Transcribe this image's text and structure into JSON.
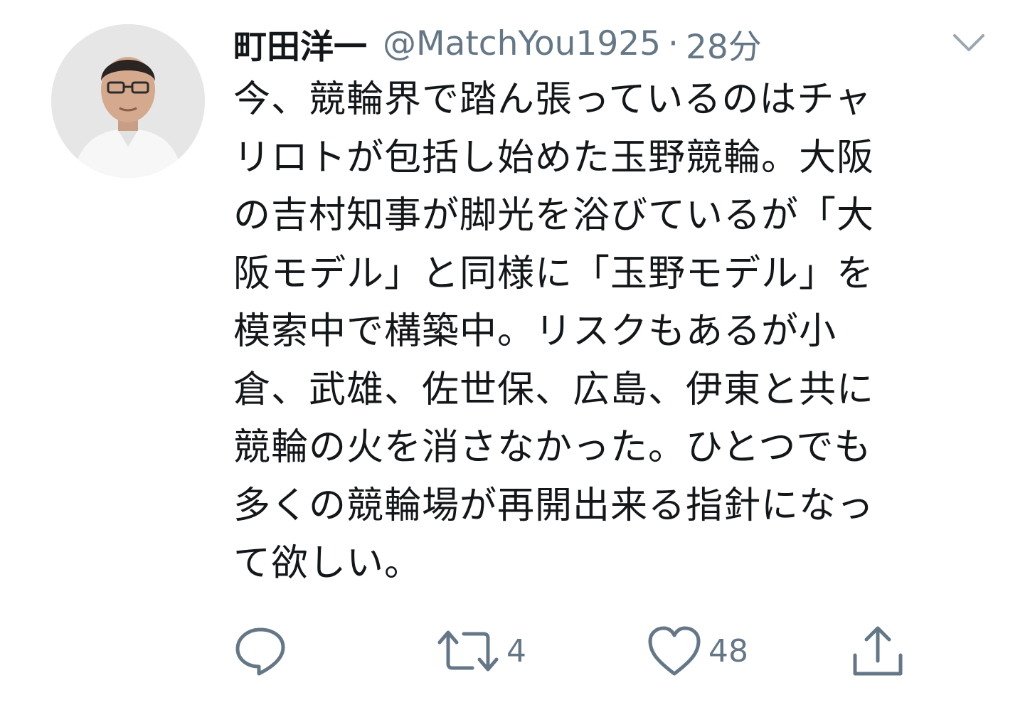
{
  "user": {
    "display_name": "町田洋一",
    "handle": "@MatchYou1925",
    "separator": "·",
    "timestamp": "28分"
  },
  "tweet": {
    "lines": [
      "今、競輪界で踏ん張っているのはチャ",
      "リロトが包括し始めた玉野競輪。大阪",
      "の吉村知事が脚光を浴びているが「大",
      "阪モデル」と同様に「玉野モデル」を",
      "模索中で構築中。リスクもあるが小",
      "倉、武雄、佐世保、広島、伊東と共に",
      "競輪の火を消さなかった。ひとつでも",
      "多くの競輪場が再開出来る指針になっ",
      "て欲しい。"
    ]
  },
  "actions": {
    "reply": {
      "icon": "reply-icon",
      "count": ""
    },
    "retweet": {
      "icon": "retweet-icon",
      "count": "4"
    },
    "like": {
      "icon": "heart-icon",
      "count": "48"
    },
    "share": {
      "icon": "share-icon",
      "count": ""
    }
  },
  "colors": {
    "text": "#14171a",
    "secondary": "#657786"
  }
}
